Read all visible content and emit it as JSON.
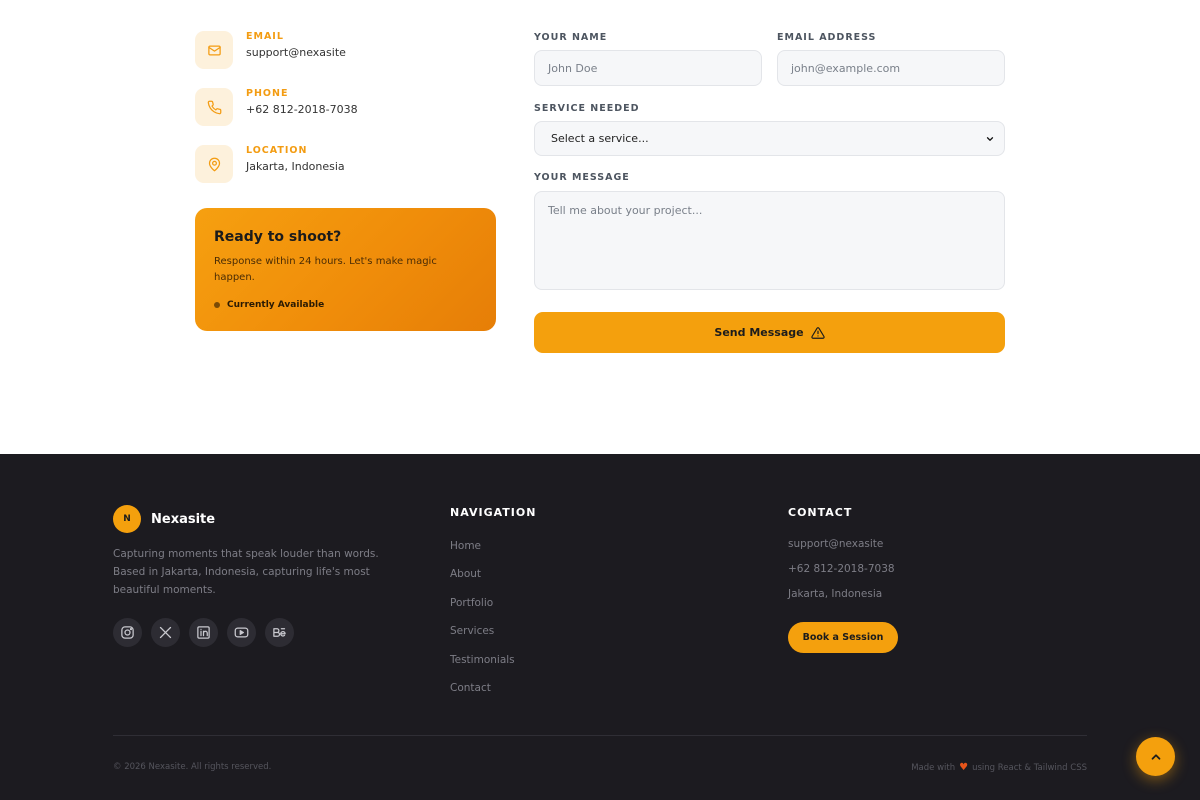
{
  "contact_info": {
    "email": {
      "label": "EMAIL",
      "value": "support@nexasite",
      "icon": "mail-icon"
    },
    "phone": {
      "label": "PHONE",
      "value": "+62 812-2018-7038",
      "icon": "phone-icon"
    },
    "location": {
      "label": "LOCATION",
      "value": "Jakarta, Indonesia",
      "icon": "map-pin-icon"
    }
  },
  "ready_card": {
    "title": "Ready to shoot?",
    "text": "Response within 24 hours. Let's make magic happen.",
    "status": "Currently Available"
  },
  "form": {
    "name_label": "YOUR NAME",
    "name_placeholder": "John Doe",
    "email_label": "EMAIL ADDRESS",
    "email_placeholder": "john@example.com",
    "service_label": "SERVICE NEEDED",
    "service_value": "Select a service...",
    "message_label": "YOUR MESSAGE",
    "message_placeholder": "Tell me about your project...",
    "send_label": "Send Message",
    "send_icon": "warning-icon"
  },
  "footer": {
    "logo_letter": "N",
    "brand": "Nexasite",
    "description": "Capturing moments that speak louder than words. Based in Jakarta, Indonesia, capturing life's most beautiful moments.",
    "socials": [
      "instagram-icon",
      "x-icon",
      "linkedin-icon",
      "youtube-icon",
      "behance-icon"
    ],
    "nav_title": "NAVIGATION",
    "nav": [
      "Home",
      "About",
      "Portfolio",
      "Services",
      "Testimonials",
      "Contact"
    ],
    "contact_title": "CONTACT",
    "contact": [
      "support@nexasite",
      "+62 812-2018-7038",
      "Jakarta, Indonesia"
    ],
    "book_label": "Book a Session",
    "copyright": "© 2026 Nexasite. All rights reserved.",
    "made_with_prefix": "Made with",
    "made_with_suffix": "using React & Tailwind CSS"
  },
  "colors": {
    "accent": "#f4a00d",
    "footer_bg": "#1c1b20",
    "label_orange": "#f39c12"
  },
  "scroll_top_icon": "chevron-up-icon"
}
